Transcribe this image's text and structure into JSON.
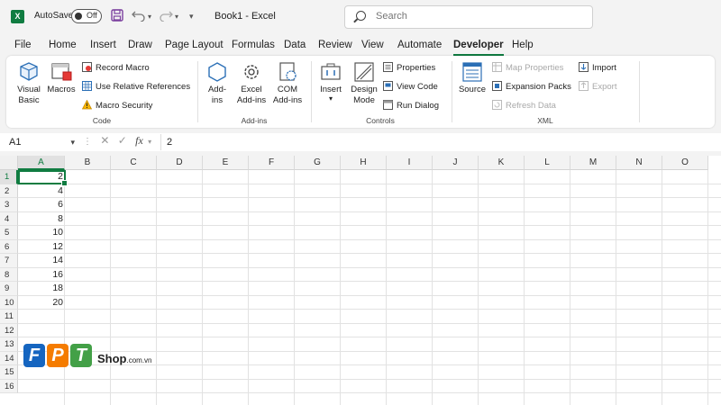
{
  "titlebar": {
    "autosave_label": "AutoSave",
    "autosave_state": "Off",
    "app_title": "Book1  -  Excel",
    "search_placeholder": "Search",
    "app_icon_letter": "X"
  },
  "tabs": [
    "File",
    "Home",
    "Insert",
    "Draw",
    "Page Layout",
    "Formulas",
    "Data",
    "Review",
    "View",
    "Automate",
    "Developer",
    "Help"
  ],
  "active_tab": "Developer",
  "ribbon": {
    "code": {
      "label": "Code",
      "visual_basic": "Visual\nBasic",
      "macros": "Macros",
      "record_macro": "Record Macro",
      "use_relative": "Use Relative References",
      "macro_security": "Macro Security"
    },
    "addins": {
      "label": "Add-ins",
      "addins": "Add-\nins",
      "excel_addins": "Excel\nAdd-ins",
      "com_addins": "COM\nAdd-ins"
    },
    "controls": {
      "label": "Controls",
      "insert": "Insert",
      "design_mode": "Design\nMode",
      "properties": "Properties",
      "view_code": "View Code",
      "run_dialog": "Run Dialog"
    },
    "xml": {
      "label": "XML",
      "source": "Source",
      "map_properties": "Map Properties",
      "expansion_packs": "Expansion Packs",
      "refresh_data": "Refresh Data",
      "import": "Import",
      "export": "Export"
    }
  },
  "formula_bar": {
    "name_box": "A1",
    "fx": "fx",
    "value": "2"
  },
  "grid": {
    "columns": [
      "A",
      "B",
      "C",
      "D",
      "E",
      "F",
      "G",
      "H",
      "I",
      "J",
      "K",
      "L",
      "M",
      "N",
      "O"
    ],
    "rows": [
      "1",
      "2",
      "3",
      "4",
      "5",
      "6",
      "7",
      "8",
      "9",
      "10",
      "11",
      "12",
      "13",
      "14",
      "15",
      "16"
    ],
    "column_a_values": [
      "2",
      "4",
      "6",
      "8",
      "10",
      "12",
      "14",
      "16",
      "18",
      "20"
    ],
    "selected_cell": "A1"
  },
  "watermark": {
    "letters": [
      "F",
      "P",
      "T"
    ],
    "shop": "Shop",
    "domain": ".com.vn",
    "colors": [
      "#1565c0",
      "#f57c00",
      "#43a047"
    ]
  },
  "colors": {
    "accent": "#107c41"
  }
}
